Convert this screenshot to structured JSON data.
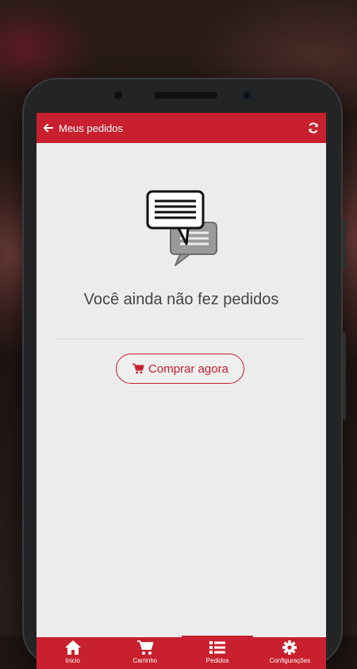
{
  "header": {
    "title": "Meus pedidos",
    "back_icon": "arrow-left-icon",
    "refresh_icon": "refresh-icon"
  },
  "empty_state": {
    "icon": "chat-bubbles-icon",
    "message": "Você ainda não fez pedidos",
    "button_label": "Comprar agora",
    "button_icon": "cart-icon"
  },
  "bottom_nav": {
    "items": [
      {
        "label": "Inicio",
        "icon": "home-icon"
      },
      {
        "label": "Carrinho",
        "icon": "cart-icon"
      },
      {
        "label": "Pedidos",
        "icon": "list-icon",
        "active": true
      },
      {
        "label": "Configurações",
        "icon": "gear-icon"
      }
    ]
  },
  "colors": {
    "accent": "#c8202e",
    "screen_bg": "#ececec",
    "text": "#454545"
  }
}
